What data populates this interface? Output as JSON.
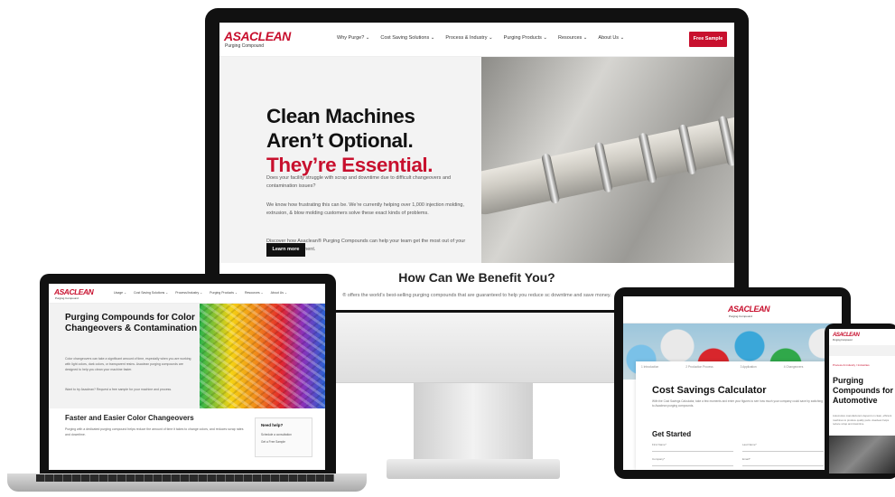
{
  "brand": {
    "logo": "ASACLEAN",
    "logo_sub": "Purging Compound",
    "accent": "#c8102e"
  },
  "desktop": {
    "nav": [
      "Why Purge? ⌄",
      "Cost Saving Solutions ⌄",
      "Process & Industry ⌄",
      "Purging Products ⌄",
      "Resources ⌄",
      "About Us ⌄"
    ],
    "cta": "Free Sample",
    "headline_1": "Clean Machines",
    "headline_2": "Aren’t Optional.",
    "headline_3": "They’re Essential.",
    "para_1": "Does your facility struggle with scrap and downtime due to difficult changeovers and contamination issues?",
    "para_2": "We know how frustrating this can be. We’re currently helping over 1,000 injection molding, extrusion, & blow molding customers solve these exact kinds of problems.",
    "para_3": "Discover how Asaclean® Purging Compounds can help your team get the most out of your production equipment.",
    "button": "Learn more",
    "section_title": "How Can We Benefit You?",
    "section_sub": "® offers the world’s best-selling purging compounds that are guaranteed to help you reduce sc downtime and save money."
  },
  "laptop": {
    "nav": [
      "Usage ⌄",
      "Cost Saving Solutions ⌄",
      "Process/Industry ⌄",
      "Purging Products ⌄",
      "Resources ⌄",
      "About Us ⌄"
    ],
    "headline": "Purging Compounds for Color Changeovers & Contamination",
    "para_1": "Color changeovers can take a significant amount of time, especially when you are working with light colors, dark colors, or transparent resins. Asaclean purging compounds are designed to help you clean your machine faster.",
    "para_2": "Want to try Asaclean? Request a free sample for your machine and process.",
    "section_title": "Faster and Easier Color Changeovers",
    "section_text": "Purging with a dedicated purging compound helps reduce the amount of time it takes to change colors, and reduces scrap rates and downtime.",
    "help_title": "Need help?",
    "help_item_1": "Schedule a consultation",
    "help_item_2": "Get a Free Sample"
  },
  "tablet": {
    "steps": [
      "1 Introduction",
      "2 Production Process",
      "3 Application",
      "4 Changeovers"
    ],
    "title": "Cost Savings Calculator",
    "para": "With the Cost Savings Calculator, take a few moments and enter your figures to see how much your company could save by switching to Asaclean purging compounds.",
    "subtitle": "Get Started",
    "fields": [
      "First Name*",
      "Last Name*",
      "Company*",
      "Email*"
    ]
  },
  "phone": {
    "crumb": "Process & Industry  /  Industries",
    "headline": "Purging Compounds for Automotive",
    "para": "Automotive manufacturers depend on clean, efficient machines to produce quality parts. Asaclean helps reduce scrap and downtime."
  }
}
